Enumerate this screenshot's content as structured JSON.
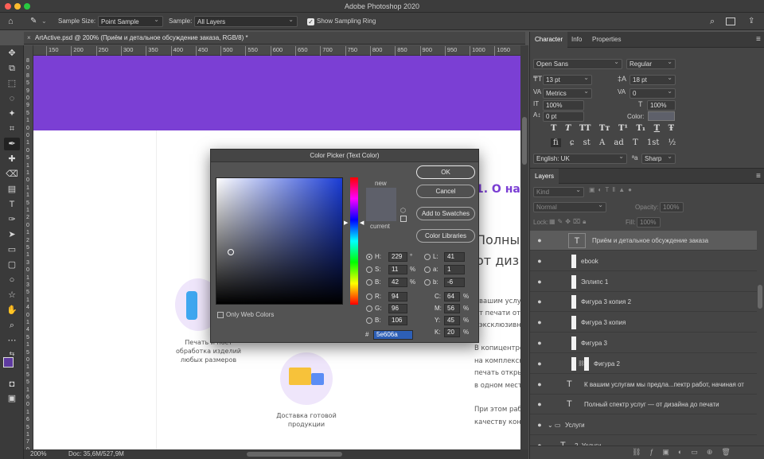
{
  "app": {
    "title": "Adobe Photoshop 2020"
  },
  "options": {
    "sample_size_label": "Sample Size:",
    "sample_size_value": "Point Sample",
    "sample_label": "Sample:",
    "sample_value": "All Layers",
    "show_ring_label": "Show Sampling Ring",
    "show_ring_checked": true
  },
  "document": {
    "tab_title": "ArtActive.psd @ 200% (Приём и детальное обсуждение заказа, RGB/8) *",
    "ruler_h": [
      "150",
      "200",
      "250",
      "300",
      "350",
      "400",
      "450",
      "500",
      "550",
      "600",
      "650",
      "700",
      "750",
      "800",
      "850",
      "900",
      "950",
      "1000",
      "1050"
    ],
    "ruler_v": [
      "8",
      "0",
      "8",
      "5",
      "9",
      "0",
      "9",
      "5",
      "1",
      "0",
      "0",
      "1",
      "0",
      "5",
      "1",
      "1",
      "0",
      "1",
      "1",
      "5",
      "1",
      "2",
      "0",
      "1",
      "2",
      "5",
      "1",
      "3",
      "0",
      "1",
      "3",
      "5",
      "1",
      "4",
      "0",
      "1",
      "4",
      "5",
      "1",
      "5",
      "0",
      "1",
      "5",
      "5",
      "1",
      "6",
      "0",
      "1",
      "6",
      "5",
      "1",
      "7",
      "0"
    ]
  },
  "canvas": {
    "header_color": "#7b3fd4",
    "heading1": "1. О на",
    "heading2a": "Полны",
    "heading2b": "от диз",
    "para1": [
      "вашим услу",
      "т печати отк",
      "эксклюзивн"
    ],
    "para2": [
      "В копицентре",
      "на комплексн",
      "печать откры",
      "в одном мест"
    ],
    "para3": [
      "При этом раб",
      "качеству коне"
    ],
    "feature1": [
      "Печать и пост",
      "обработка изделий",
      "любых размеров"
    ],
    "feature2": [
      "Доставка готовой",
      "продукции"
    ]
  },
  "status": {
    "zoom": "200%",
    "doc": "Doc: 35,6M/527,9M"
  },
  "character_panel": {
    "tabs": [
      "Character",
      "Info",
      "Properties"
    ],
    "font_family": "Open Sans",
    "font_style": "Regular",
    "font_size": "13 pt",
    "leading": "18 pt",
    "kerning": "Metrics",
    "tracking": "0",
    "vscale": "100%",
    "hscale": "100%",
    "baseline": "0 pt",
    "color_label": "Color:",
    "language": "English: UK",
    "aa_label": "aa",
    "antialias": "Sharp",
    "type_styles": [
      "T",
      "T",
      "TT",
      "Tт",
      "T¹",
      "T₁",
      "T",
      "Ŧ"
    ],
    "opentype": [
      "fi",
      "ɕ",
      "st",
      "A",
      "ad",
      "T",
      "1st",
      "½"
    ]
  },
  "layers_panel": {
    "tab": "Layers",
    "filter": "Kind",
    "blend": "Normal",
    "opacity_label": "Opacity:",
    "opacity": "100%",
    "lock_label": "Lock:",
    "fill_label": "Fill:",
    "fill": "100%",
    "layers": [
      {
        "name": "Приём и детальное обсуждение заказа",
        "type": "text",
        "selected": true
      },
      {
        "name": "ebook",
        "type": "shape"
      },
      {
        "name": "Эллипс 1",
        "type": "shape"
      },
      {
        "name": "Фигура 3 копия 2",
        "type": "shape"
      },
      {
        "name": "Фигура 3 копия",
        "type": "shape"
      },
      {
        "name": "Фигура 3",
        "type": "shape"
      },
      {
        "name": "Фигура 2",
        "type": "shape-linked"
      },
      {
        "name": "К вашим услугам мы предла...пектр работ, начиная  от",
        "type": "text"
      },
      {
        "name": "Полный спектр услуг —  от дизайна до печати",
        "type": "text"
      },
      {
        "name": "Услуги",
        "type": "group"
      },
      {
        "name": "2. Услуги",
        "type": "text"
      }
    ]
  },
  "color_picker": {
    "title": "Color Picker (Text Color)",
    "ok": "OK",
    "cancel": "Cancel",
    "add_swatches": "Add to Swatches",
    "color_libraries": "Color Libraries",
    "new_label": "new",
    "current_label": "current",
    "only_web": "Only Web Colors",
    "new_color": "#5e606a",
    "current_color": "#5e606a",
    "hue_color": "#1a3cd6",
    "H": "229",
    "S": "11",
    "B": "42",
    "R": "94",
    "G": "96",
    "Bl": "106",
    "L": "41",
    "a": "1",
    "b": "-6",
    "C": "64",
    "M": "56",
    "Y": "45",
    "K": "20",
    "hex": "5e606a",
    "labels": {
      "H": "H:",
      "S": "S:",
      "B": "B:",
      "R": "R:",
      "G": "G:",
      "Bl": "B:",
      "L": "L:",
      "a": "a:",
      "b": "b:",
      "C": "C:",
      "M": "M:",
      "Y": "Y:",
      "K": "K:",
      "hash": "#"
    },
    "units": {
      "deg": "°",
      "pct": "%"
    }
  }
}
